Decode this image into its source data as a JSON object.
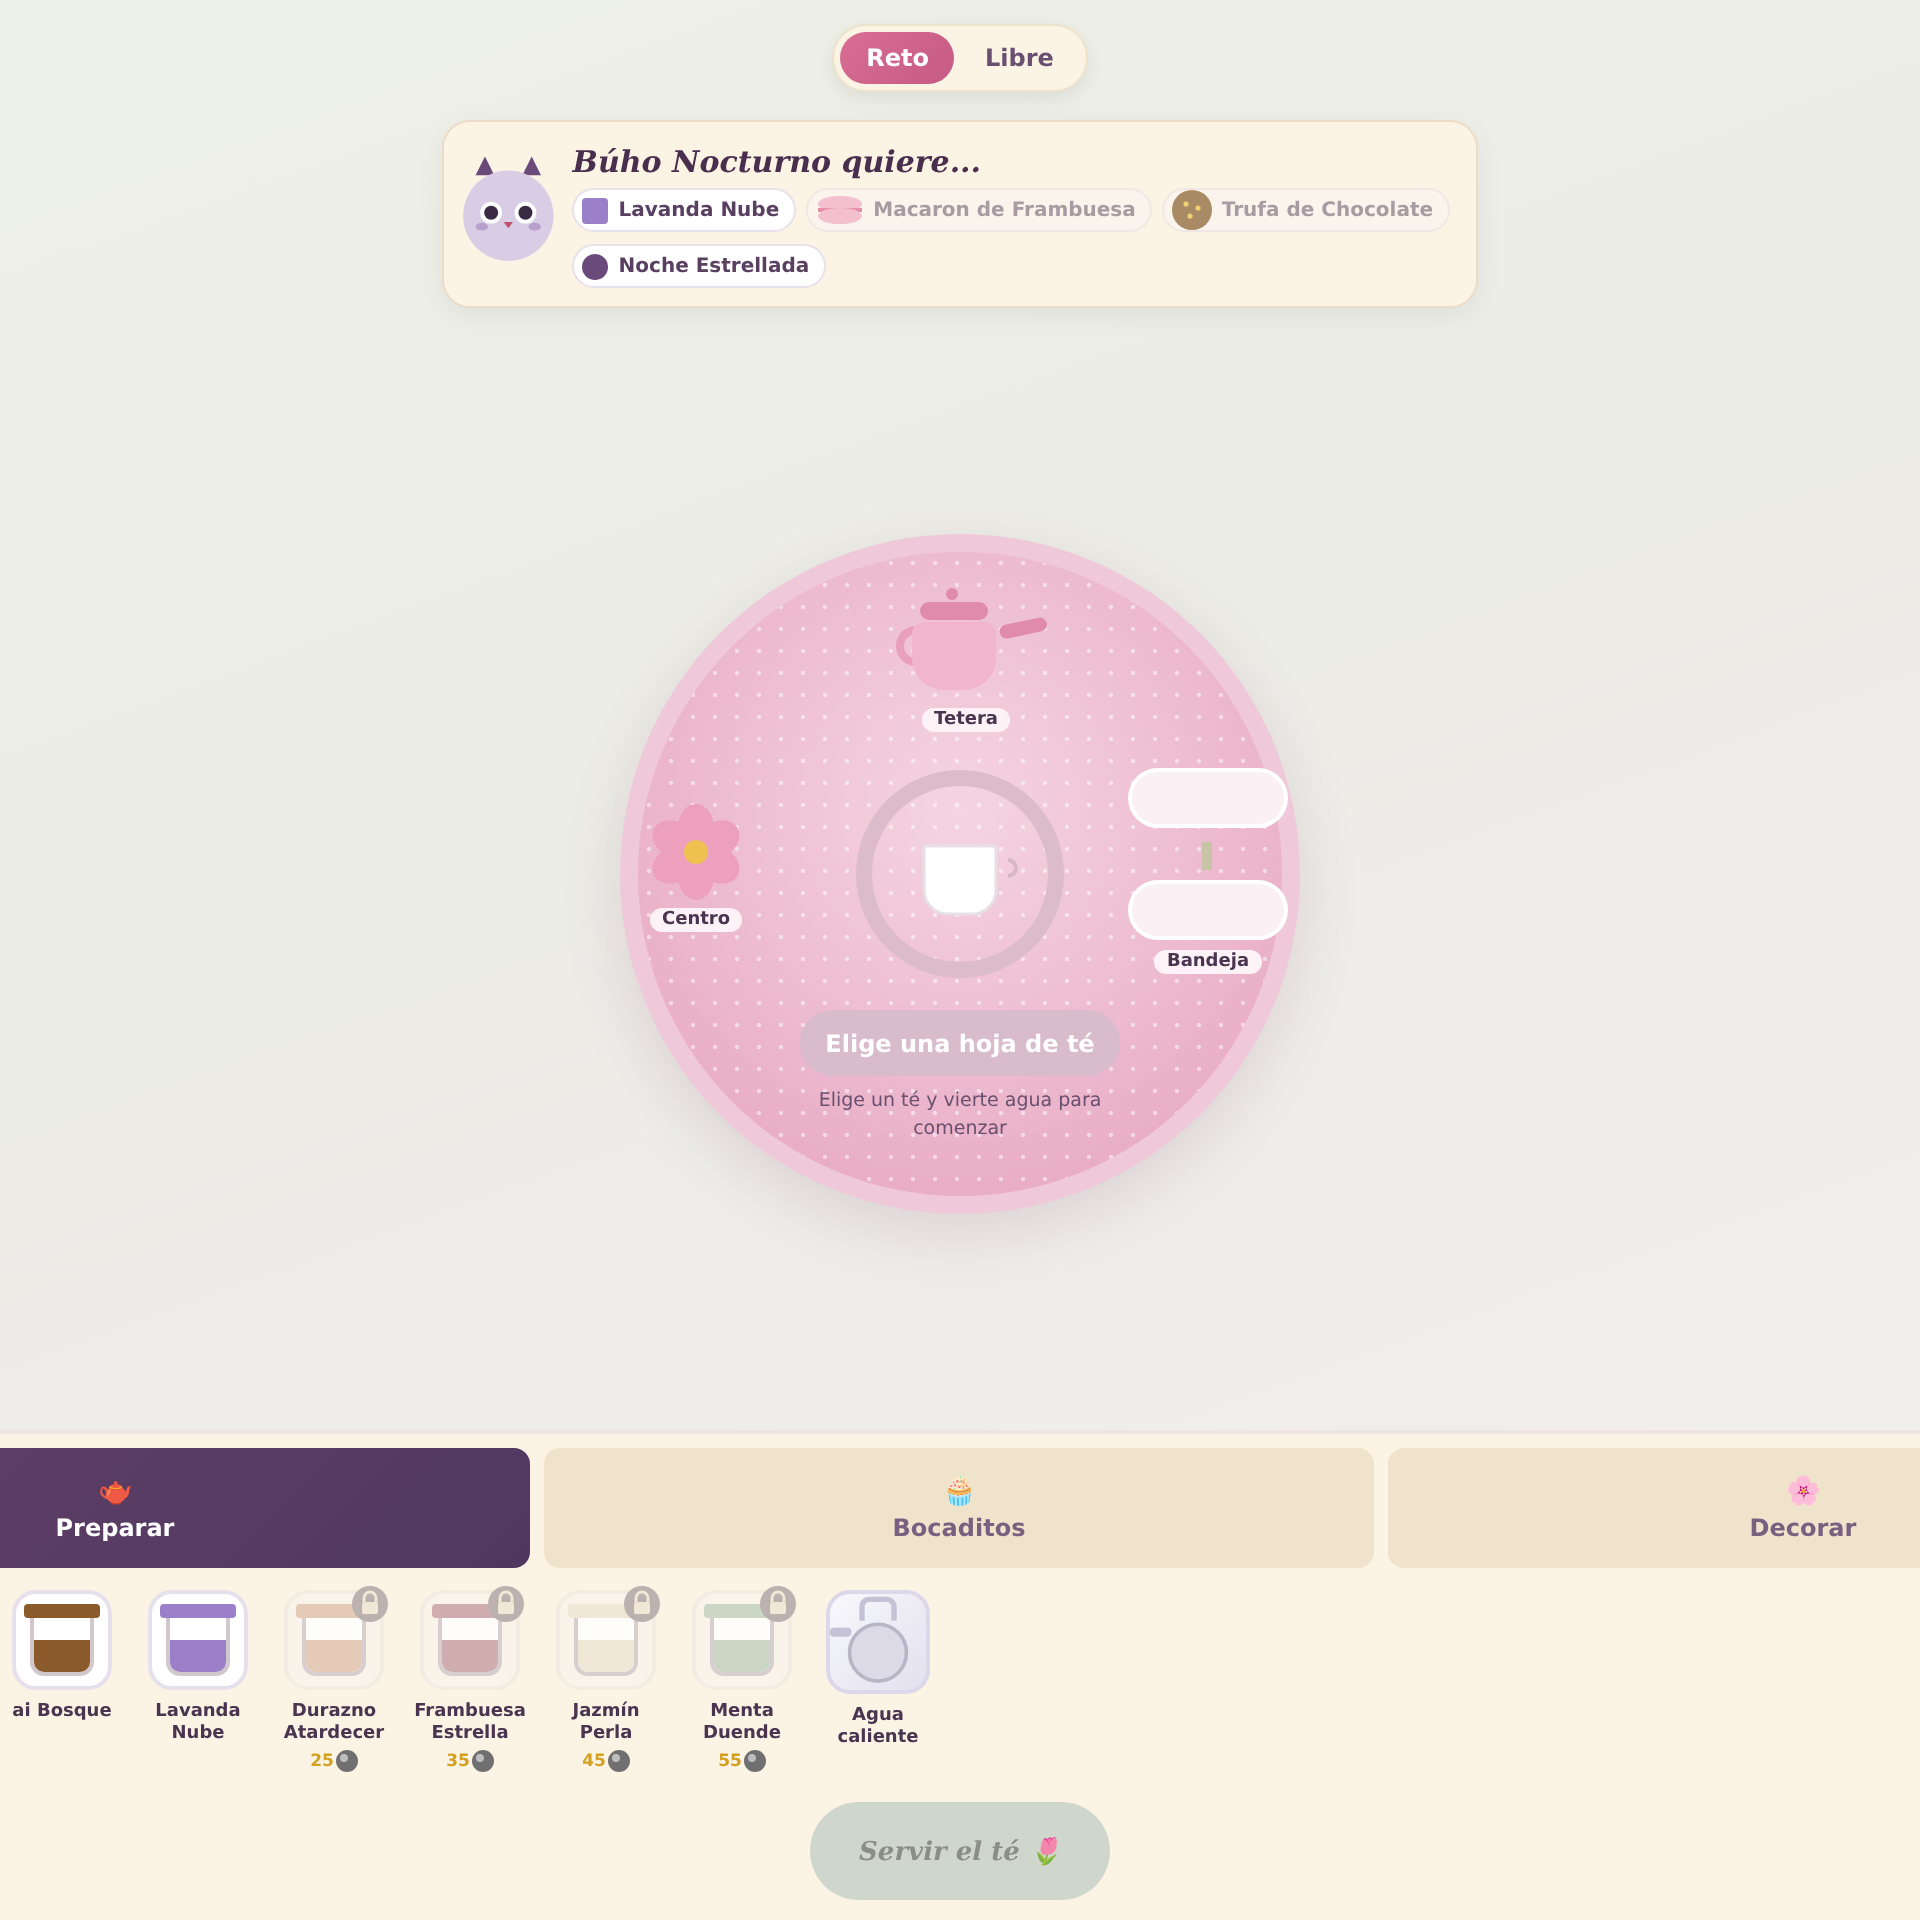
{
  "mode_toggle": [
    {
      "label": "Reto",
      "selected": true
    },
    {
      "label": "Libre",
      "selected": false
    }
  ],
  "order": {
    "title": "Búho Nocturno quiere...",
    "items": [
      {
        "label": "Lavanda Nube",
        "kind": "square",
        "color": "#9b7fc8",
        "dimmed": false
      },
      {
        "label": "Macaron de Frambuesa",
        "kind": "macaron",
        "dimmed": true
      },
      {
        "label": "Trufa de Chocolate",
        "kind": "truffle",
        "dimmed": true
      },
      {
        "label": "Noche Estrellada",
        "kind": "circle",
        "color": "#6a4a7a",
        "dimmed": false
      }
    ]
  },
  "table": {
    "stations": [
      {
        "label": "Tetera",
        "kind": "teapot"
      },
      {
        "label": "Centro",
        "kind": "flower"
      },
      {
        "label": "Bandeja",
        "kind": "tray"
      }
    ],
    "action_button": {
      "label": "Elige una hoja de té",
      "disabled": true
    },
    "hint": "Elige un té y vierte agua para comenzar"
  },
  "tabs": [
    {
      "label": "Preparar",
      "icon": "🫖",
      "selected": true
    },
    {
      "label": "Bocaditos",
      "icon": "🧁",
      "selected": false
    },
    {
      "label": "Decorar",
      "icon": "🌸",
      "selected": false
    }
  ],
  "ingredients": [
    {
      "label": "ai Bosque",
      "kind": "jar",
      "color": "#8a5a2b",
      "locked": false
    },
    {
      "label": "Lavanda Nube",
      "kind": "jar",
      "color": "#9b7fc8",
      "locked": false
    },
    {
      "label": "Durazno Atardecer",
      "kind": "jar",
      "color": "#e0c4b0",
      "locked": true,
      "price": "25"
    },
    {
      "label": "Frambuesa Estrella",
      "kind": "jar",
      "color": "#c9a2a8",
      "locked": true,
      "price": "35"
    },
    {
      "label": "Jazmín Perla",
      "kind": "jar",
      "color": "#efe6d4",
      "locked": true,
      "price": "45"
    },
    {
      "label": "Menta Duende",
      "kind": "jar",
      "color": "#c4d2bf",
      "locked": true,
      "price": "55"
    },
    {
      "label": "Agua caliente",
      "kind": "kettle"
    }
  ],
  "serve_button": {
    "label": "Servir el té",
    "icon": "🌷",
    "disabled": true
  }
}
